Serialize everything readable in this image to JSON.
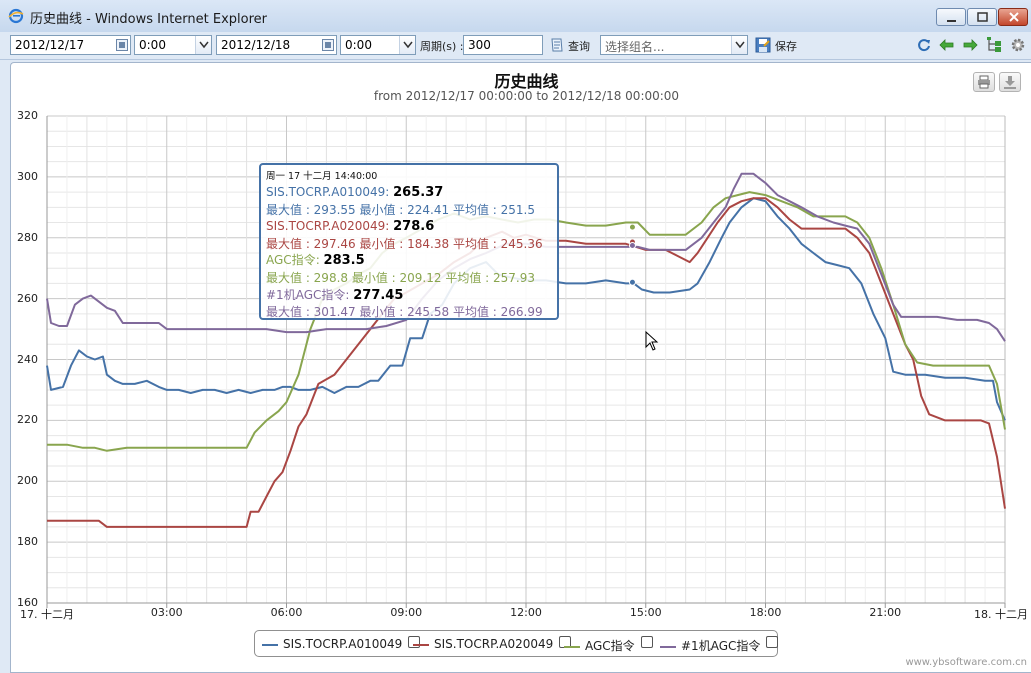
{
  "window": {
    "title": "历史曲线 - Windows Internet Explorer"
  },
  "toolbar": {
    "start_date": "2012/12/17",
    "start_time": "0:00",
    "end_date": "2012/12/18",
    "end_time": "0:00",
    "period_label": "周期(s) :",
    "period_value": "300",
    "query_label": "查询",
    "group_placeholder": "选择组名...",
    "save_label": "保存",
    "icons": [
      "refresh-icon",
      "back-arrow-icon",
      "forward-arrow-icon",
      "tree-icon",
      "gear-icon"
    ]
  },
  "chart_data": {
    "type": "line",
    "title": "历史曲线",
    "subtitle": "from 2012/12/17 00:00:00 to 2012/12/18 00:00:00",
    "xlabel": "",
    "ylabel": "",
    "xlim": [
      0,
      24
    ],
    "ylim": [
      160,
      320
    ],
    "y_ticks": [
      "320",
      "300",
      "280",
      "260",
      "240",
      "220",
      "200",
      "180",
      "160"
    ],
    "x_ticks": [
      {
        "x": 0,
        "label": "17. 十二月"
      },
      {
        "x": 3,
        "label": "03:00"
      },
      {
        "x": 6,
        "label": "06:00"
      },
      {
        "x": 9,
        "label": "09:00"
      },
      {
        "x": 12,
        "label": "12:00"
      },
      {
        "x": 15,
        "label": "15:00"
      },
      {
        "x": 18,
        "label": "18:00"
      },
      {
        "x": 21,
        "label": "21:00"
      },
      {
        "x": 24,
        "label": "18. 十二月"
      }
    ],
    "grid": true,
    "legend_position": "bottom-center",
    "series": [
      {
        "name": "SIS.TOCRP.A010049",
        "color": "#4572a7",
        "points": [
          [
            0,
            238
          ],
          [
            0.1,
            230
          ],
          [
            0.4,
            231
          ],
          [
            0.6,
            238
          ],
          [
            0.8,
            243
          ],
          [
            1.0,
            241
          ],
          [
            1.2,
            240
          ],
          [
            1.4,
            241
          ],
          [
            1.5,
            235
          ],
          [
            1.7,
            233
          ],
          [
            1.9,
            232
          ],
          [
            2.2,
            232
          ],
          [
            2.5,
            233
          ],
          [
            2.8,
            231
          ],
          [
            3.0,
            230
          ],
          [
            3.3,
            230
          ],
          [
            3.6,
            229
          ],
          [
            3.9,
            230
          ],
          [
            4.2,
            230
          ],
          [
            4.5,
            229
          ],
          [
            4.8,
            230
          ],
          [
            5.1,
            229
          ],
          [
            5.4,
            230
          ],
          [
            5.7,
            230
          ],
          [
            5.9,
            231
          ],
          [
            6.1,
            231
          ],
          [
            6.3,
            230
          ],
          [
            6.6,
            230
          ],
          [
            6.9,
            231
          ],
          [
            7.2,
            229
          ],
          [
            7.5,
            231
          ],
          [
            7.8,
            231
          ],
          [
            8.1,
            233
          ],
          [
            8.3,
            233
          ],
          [
            8.6,
            238
          ],
          [
            8.9,
            238
          ],
          [
            9.1,
            247
          ],
          [
            9.4,
            247
          ],
          [
            9.6,
            255
          ],
          [
            9.9,
            258
          ],
          [
            10.2,
            265
          ],
          [
            10.6,
            270
          ],
          [
            11.0,
            272
          ],
          [
            11.3,
            268
          ],
          [
            11.6,
            267
          ],
          [
            12.0,
            266
          ],
          [
            12.5,
            266
          ],
          [
            13.0,
            265
          ],
          [
            13.5,
            265
          ],
          [
            14.0,
            266
          ],
          [
            14.5,
            265
          ],
          [
            14.7,
            265
          ],
          [
            14.9,
            263
          ],
          [
            15.2,
            262
          ],
          [
            15.6,
            262
          ],
          [
            16.1,
            263
          ],
          [
            16.3,
            265
          ],
          [
            16.6,
            272
          ],
          [
            16.9,
            280
          ],
          [
            17.1,
            285
          ],
          [
            17.4,
            290
          ],
          [
            17.7,
            293
          ],
          [
            18.0,
            292
          ],
          [
            18.3,
            287
          ],
          [
            18.6,
            283
          ],
          [
            18.9,
            278
          ],
          [
            19.2,
            275
          ],
          [
            19.5,
            272
          ],
          [
            19.8,
            271
          ],
          [
            20.1,
            270
          ],
          [
            20.4,
            265
          ],
          [
            20.7,
            255
          ],
          [
            21.0,
            247
          ],
          [
            21.2,
            236
          ],
          [
            21.5,
            235
          ],
          [
            22.0,
            235
          ],
          [
            22.5,
            234
          ],
          [
            23.0,
            234
          ],
          [
            23.5,
            233
          ],
          [
            23.7,
            233
          ],
          [
            23.8,
            226
          ],
          [
            24,
            220
          ]
        ]
      },
      {
        "name": "SIS.TOCRP.A020049",
        "color": "#aa4643",
        "points": [
          [
            0,
            187
          ],
          [
            0.5,
            187
          ],
          [
            1.0,
            187
          ],
          [
            1.3,
            187
          ],
          [
            1.5,
            185
          ],
          [
            2.0,
            185
          ],
          [
            2.5,
            185
          ],
          [
            3.0,
            185
          ],
          [
            3.5,
            185
          ],
          [
            4.0,
            185
          ],
          [
            4.5,
            185
          ],
          [
            5.0,
            185
          ],
          [
            5.1,
            190
          ],
          [
            5.3,
            190
          ],
          [
            5.5,
            195
          ],
          [
            5.7,
            200
          ],
          [
            5.9,
            203
          ],
          [
            6.1,
            210
          ],
          [
            6.3,
            218
          ],
          [
            6.5,
            222
          ],
          [
            6.8,
            232
          ],
          [
            7.2,
            235
          ],
          [
            7.5,
            240
          ],
          [
            7.8,
            245
          ],
          [
            8.1,
            250
          ],
          [
            8.4,
            255
          ],
          [
            8.7,
            260
          ],
          [
            9.0,
            262
          ],
          [
            9.4,
            265
          ],
          [
            9.8,
            268
          ],
          [
            10.2,
            272
          ],
          [
            10.6,
            275
          ],
          [
            11.0,
            280
          ],
          [
            11.4,
            282
          ],
          [
            11.7,
            280
          ],
          [
            12.0,
            281
          ],
          [
            12.5,
            279
          ],
          [
            13.0,
            279
          ],
          [
            13.5,
            278
          ],
          [
            14.0,
            278
          ],
          [
            14.5,
            278
          ],
          [
            15.0,
            276
          ],
          [
            15.5,
            276
          ],
          [
            15.8,
            274
          ],
          [
            16.1,
            272
          ],
          [
            16.3,
            275
          ],
          [
            16.5,
            279
          ],
          [
            16.8,
            285
          ],
          [
            17.1,
            290
          ],
          [
            17.4,
            292
          ],
          [
            17.7,
            293
          ],
          [
            18.0,
            293
          ],
          [
            18.3,
            290
          ],
          [
            18.6,
            286
          ],
          [
            18.9,
            283
          ],
          [
            19.5,
            283
          ],
          [
            20.0,
            283
          ],
          [
            20.3,
            280
          ],
          [
            20.6,
            275
          ],
          [
            20.9,
            265
          ],
          [
            21.2,
            255
          ],
          [
            21.5,
            245
          ],
          [
            21.7,
            240
          ],
          [
            21.9,
            228
          ],
          [
            22.1,
            222
          ],
          [
            22.5,
            220
          ],
          [
            23.0,
            220
          ],
          [
            23.4,
            220
          ],
          [
            23.6,
            219
          ],
          [
            23.8,
            208
          ],
          [
            24,
            191
          ]
        ]
      },
      {
        "name": "AGC指令",
        "color": "#89a54e",
        "points": [
          [
            0,
            212
          ],
          [
            0.5,
            212
          ],
          [
            0.9,
            211
          ],
          [
            1.2,
            211
          ],
          [
            1.5,
            210
          ],
          [
            2.0,
            211
          ],
          [
            2.5,
            211
          ],
          [
            3.0,
            211
          ],
          [
            3.5,
            211
          ],
          [
            4.0,
            211
          ],
          [
            4.5,
            211
          ],
          [
            5.0,
            211
          ],
          [
            5.2,
            216
          ],
          [
            5.5,
            220
          ],
          [
            5.8,
            223
          ],
          [
            6.0,
            226
          ],
          [
            6.3,
            235
          ],
          [
            6.6,
            250
          ],
          [
            6.9,
            260
          ],
          [
            7.2,
            263
          ],
          [
            7.5,
            265
          ],
          [
            7.8,
            268
          ],
          [
            8.1,
            270
          ],
          [
            8.4,
            275
          ],
          [
            8.7,
            278
          ],
          [
            9.0,
            280
          ],
          [
            9.4,
            283
          ],
          [
            9.8,
            286
          ],
          [
            10.2,
            288
          ],
          [
            10.6,
            286
          ],
          [
            11.0,
            287
          ],
          [
            11.4,
            286
          ],
          [
            11.8,
            285
          ],
          [
            12.2,
            286
          ],
          [
            12.6,
            286
          ],
          [
            13.0,
            285
          ],
          [
            13.5,
            284
          ],
          [
            14.0,
            284
          ],
          [
            14.5,
            285
          ],
          [
            14.8,
            285
          ],
          [
            15.1,
            281
          ],
          [
            15.5,
            281
          ],
          [
            16.0,
            281
          ],
          [
            16.4,
            285
          ],
          [
            16.7,
            290
          ],
          [
            17.0,
            293
          ],
          [
            17.3,
            294
          ],
          [
            17.6,
            295
          ],
          [
            18.0,
            294
          ],
          [
            18.4,
            292
          ],
          [
            18.8,
            290
          ],
          [
            19.2,
            287
          ],
          [
            19.6,
            287
          ],
          [
            20.0,
            287
          ],
          [
            20.3,
            285
          ],
          [
            20.6,
            280
          ],
          [
            20.9,
            270
          ],
          [
            21.2,
            258
          ],
          [
            21.5,
            245
          ],
          [
            21.8,
            239
          ],
          [
            22.2,
            238
          ],
          [
            22.7,
            238
          ],
          [
            23.2,
            238
          ],
          [
            23.6,
            238
          ],
          [
            23.8,
            232
          ],
          [
            24,
            217
          ]
        ]
      },
      {
        "name": "#1机AGC指令",
        "color": "#80699b",
        "points": [
          [
            0,
            260
          ],
          [
            0.1,
            252
          ],
          [
            0.3,
            251
          ],
          [
            0.5,
            251
          ],
          [
            0.7,
            258
          ],
          [
            0.9,
            260
          ],
          [
            1.1,
            261
          ],
          [
            1.3,
            259
          ],
          [
            1.5,
            257
          ],
          [
            1.7,
            256
          ],
          [
            1.9,
            252
          ],
          [
            2.2,
            252
          ],
          [
            2.5,
            252
          ],
          [
            2.8,
            252
          ],
          [
            3.0,
            250
          ],
          [
            3.5,
            250
          ],
          [
            4.0,
            250
          ],
          [
            4.5,
            250
          ],
          [
            5.0,
            250
          ],
          [
            5.5,
            250
          ],
          [
            6.0,
            249
          ],
          [
            6.5,
            249
          ],
          [
            7.0,
            250
          ],
          [
            7.5,
            250
          ],
          [
            8.0,
            250
          ],
          [
            8.5,
            251
          ],
          [
            9.0,
            253
          ],
          [
            9.4,
            260
          ],
          [
            9.8,
            266
          ],
          [
            10.2,
            270
          ],
          [
            10.6,
            273
          ],
          [
            11.0,
            275
          ],
          [
            11.5,
            278
          ],
          [
            12.0,
            278
          ],
          [
            12.5,
            277
          ],
          [
            13.0,
            277
          ],
          [
            13.5,
            277
          ],
          [
            14.0,
            277
          ],
          [
            14.5,
            277
          ],
          [
            14.8,
            277
          ],
          [
            15.1,
            276
          ],
          [
            15.5,
            276
          ],
          [
            16.0,
            276
          ],
          [
            16.4,
            280
          ],
          [
            16.7,
            285
          ],
          [
            17.0,
            290
          ],
          [
            17.2,
            296
          ],
          [
            17.4,
            301
          ],
          [
            17.7,
            301
          ],
          [
            18.0,
            298
          ],
          [
            18.3,
            294
          ],
          [
            18.6,
            292
          ],
          [
            18.9,
            290
          ],
          [
            19.3,
            287
          ],
          [
            19.7,
            285
          ],
          [
            20.0,
            284
          ],
          [
            20.3,
            283
          ],
          [
            20.6,
            278
          ],
          [
            20.9,
            268
          ],
          [
            21.2,
            258
          ],
          [
            21.4,
            254
          ],
          [
            21.8,
            254
          ],
          [
            22.3,
            254
          ],
          [
            22.8,
            253
          ],
          [
            23.3,
            253
          ],
          [
            23.6,
            252
          ],
          [
            23.8,
            250
          ],
          [
            24,
            246
          ]
        ]
      }
    ],
    "tooltip": {
      "header": "周一 17 十二月 14:40:00",
      "x": 14.667,
      "entries": [
        {
          "name": "SIS.TOCRP.A010049",
          "value": "265.37",
          "stats": "最大值 : 293.55 最小值 : 224.41 平均值 : 251.5"
        },
        {
          "name": "SIS.TOCRP.A020049",
          "value": "278.6",
          "stats": "最大值 : 297.46 最小值 : 184.38 平均值 : 245.36"
        },
        {
          "name": "AGC指令",
          "value": "283.5",
          "stats": "最大值 : 298.8 最小值 : 209.12 平均值 : 257.93"
        },
        {
          "name": "#1机AGC指令",
          "value": "277.45",
          "stats": "最大值 : 301.47 最小值 : 245.58 平均值 : 266.99"
        }
      ]
    },
    "credits": "www.ybsoftware.com.cn"
  }
}
